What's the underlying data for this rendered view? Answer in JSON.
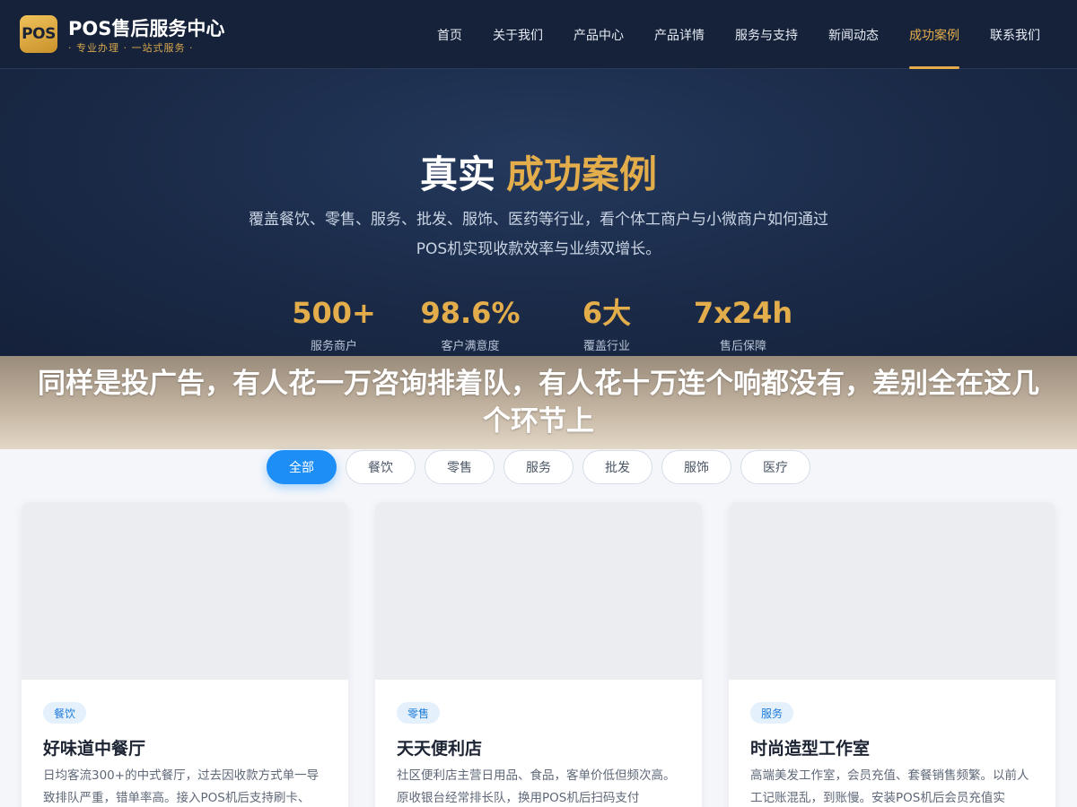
{
  "header": {
    "logo_badge": "POS",
    "logo_title": "POS售后服务中心",
    "logo_subtitle": "· 专业办理 · 一站式服务 ·",
    "nav": [
      {
        "label": "首页",
        "active": false
      },
      {
        "label": "关于我们",
        "active": false
      },
      {
        "label": "产品中心",
        "active": false
      },
      {
        "label": "产品详情",
        "active": false
      },
      {
        "label": "服务与支持",
        "active": false
      },
      {
        "label": "新闻动态",
        "active": false
      },
      {
        "label": "成功案例",
        "active": true
      },
      {
        "label": "联系我们",
        "active": false
      }
    ]
  },
  "hero": {
    "title_plain": "真实",
    "title_accent": "成功案例",
    "description": "覆盖餐饮、零售、服务、批发、服饰、医药等行业，看个体工商户与小微商户如何通过POS机实现收款效率与业绩双增长。",
    "stats": [
      {
        "value": "500+",
        "label": "服务商户"
      },
      {
        "value": "98.6%",
        "label": "客户满意度"
      },
      {
        "value": "6大",
        "label": "覆盖行业"
      },
      {
        "value": "7x24h",
        "label": "售后保障"
      }
    ]
  },
  "banner": {
    "text": "同样是投广告，有人花一万咨询排着队，有人花十万连个响都没有，差别全在这几个环节上"
  },
  "filters": [
    {
      "label": "全部",
      "active": true
    },
    {
      "label": "餐饮",
      "active": false
    },
    {
      "label": "零售",
      "active": false
    },
    {
      "label": "服务",
      "active": false
    },
    {
      "label": "批发",
      "active": false
    },
    {
      "label": "服饰",
      "active": false
    },
    {
      "label": "医疗",
      "active": false
    }
  ],
  "cases": [
    {
      "tag": "餐饮",
      "title": "好味道中餐厅",
      "description": "日均客流300+的中式餐厅，过去因收款方式单一导致排队严重，错单率高。接入POS机后支持刷卡、"
    },
    {
      "tag": "零售",
      "title": "天天便利店",
      "description": "社区便利店主营日用品、食品，客单价低但频次高。原收银台经常排长队，换用POS机后扫码支付"
    },
    {
      "tag": "服务",
      "title": "时尚造型工作室",
      "description": "高端美发工作室，会员充值、套餐销售频繁。以前人工记账混乱，到账慢。安装POS机后会员充值实"
    }
  ],
  "colors": {
    "header_bg": "#16223a",
    "accent_gold": "#e3ad4b",
    "primary_blue": "#1c8ef5"
  }
}
